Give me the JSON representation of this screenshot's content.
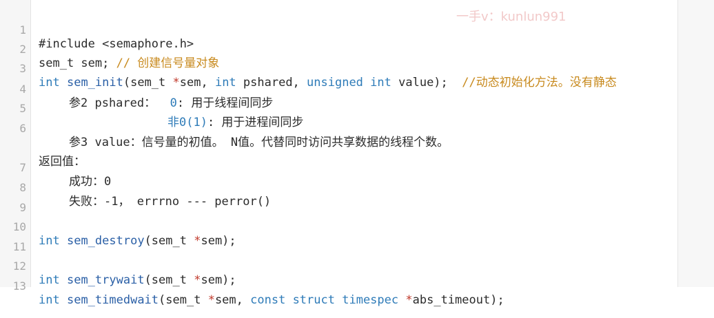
{
  "watermark": "一手v：kunlun991",
  "lines": [
    {
      "n": "1",
      "parts": [
        "#include <semaphore.h>"
      ]
    },
    {
      "n": "2",
      "parts": [
        "sem_t sem; ",
        "// 创建信号量对象"
      ]
    },
    {
      "n": "3",
      "parts": [
        "int",
        " ",
        "sem_init",
        "(sem_t ",
        "*",
        "sem, ",
        "int",
        " pshared, ",
        "unsigned",
        " ",
        "int",
        " value);  ",
        "//动态初始化方法。没有静态"
      ]
    },
    {
      "n": "4",
      "parts": [
        "参2 pshared：  ",
        "0",
        ": 用于线程间同步"
      ]
    },
    {
      "n": "5",
      "parts": [
        "非0(1)",
        ": 用于进程间同步"
      ]
    },
    {
      "n": "6",
      "parts": [
        "参3 value：信号量的初值。 N值。代替同时访问共享数据的线程个数。"
      ]
    },
    {
      "n": "",
      "parts": [
        "返回值："
      ]
    },
    {
      "n": "7",
      "parts": [
        "成功：0"
      ]
    },
    {
      "n": "8",
      "parts": [
        "失败：-1， errrno --- perror()"
      ]
    },
    {
      "n": "9",
      "parts": [
        ""
      ]
    },
    {
      "n": "10",
      "parts": [
        "int",
        " ",
        "sem_destroy",
        "(sem_t ",
        "*",
        "sem);"
      ]
    },
    {
      "n": "11",
      "parts": [
        ""
      ]
    },
    {
      "n": "12",
      "parts": [
        "int",
        " ",
        "sem_trywait",
        "(sem_t ",
        "*",
        "sem);"
      ]
    },
    {
      "n": "13",
      "parts": [
        "int",
        " ",
        "sem_timedwait",
        "(sem_t ",
        "*",
        "sem, ",
        "const",
        " ",
        "struct",
        " ",
        "timespec",
        " ",
        "*",
        "abs_timeout);"
      ]
    }
  ]
}
